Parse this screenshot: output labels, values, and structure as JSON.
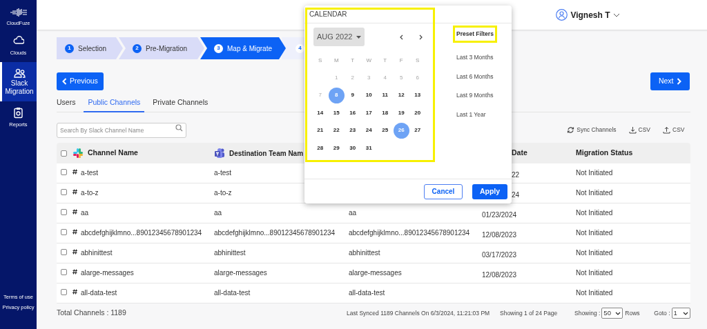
{
  "sidebar": {
    "brand": "CloudFuze",
    "items": [
      {
        "label": "Clouds",
        "kind": "cloud",
        "selected": false
      },
      {
        "label": "Slack Migration",
        "kind": "users",
        "selected": true
      },
      {
        "label": "Reports",
        "kind": "clipboard",
        "selected": false
      }
    ],
    "footer_links": [
      "Terms of use",
      "Privacy policy"
    ]
  },
  "header": {
    "user_name": "Vignesh T"
  },
  "steps": [
    {
      "number": "1",
      "label": "Selection",
      "completed": true,
      "selected": false
    },
    {
      "number": "2",
      "label": "Pre-Migration",
      "completed": true,
      "selected": false
    },
    {
      "number": "3",
      "label": "Map & Migrate",
      "completed": false,
      "selected": true
    },
    {
      "number": "4",
      "completed": false,
      "selected": false
    }
  ],
  "previous_button": "Previous",
  "next_button": "Next",
  "tabs": [
    {
      "label": "Users",
      "selected": false
    },
    {
      "label": "Public Channels",
      "selected": true
    },
    {
      "label": "Private Channels",
      "selected": false
    }
  ],
  "search": {
    "placeholder": "Search By Slack Channel Name"
  },
  "toolbar": [
    {
      "kind": "sync",
      "label": "Sync Channels"
    },
    {
      "kind": "download",
      "label": "CSV"
    },
    {
      "kind": "upload",
      "label": "CSV"
    }
  ],
  "table": {
    "select_all_checked": false,
    "columns": [
      {
        "label": "Channel Name",
        "kind": "slack"
      },
      {
        "label": "Destination Team Nam",
        "kind": "teams"
      },
      {},
      {
        "label": "Date",
        "partial": true
      },
      {
        "label": "Migration Status"
      }
    ],
    "rows": [
      {
        "checked": false,
        "channel_name": "a-test",
        "destination_team_name": "a-test",
        "date": "22",
        "date_partial": true,
        "migration_status": "Not Initiated"
      },
      {
        "checked": false,
        "channel_name": "a-to-z",
        "destination_team_name": "a-to-z",
        "date": "24",
        "date_partial": true,
        "migration_status": "Not Initiated"
      },
      {
        "checked": false,
        "channel_name": "aa",
        "destination_team_name": "aa",
        "column_3": "aa",
        "date": "01/23/2024",
        "migration_status": "Not Initiated"
      },
      {
        "checked": false,
        "channel_name": "abcdefghijklmno...89012345678901234",
        "destination_team_name": "abcdefghijklmno...89012345678901234",
        "column_3": "abcdefghijklmno...89012345678901234",
        "date": "12/08/2023",
        "migration_status": "Not Initiated"
      },
      {
        "checked": false,
        "channel_name": "abhinittest",
        "destination_team_name": "abhinittest",
        "column_3": "abhinittest",
        "date": "03/17/2023",
        "migration_status": "Not Initiated"
      },
      {
        "checked": false,
        "channel_name": "alarge-messages",
        "destination_team_name": "alarge-messages",
        "column_3": "alarge-messages",
        "date": "12/08/2023",
        "migration_status": "Not Initiated"
      },
      {
        "checked": false,
        "channel_name": "all-data-test",
        "destination_team_name": "all-data-test",
        "column_3": "all-data-test",
        "migration_status": "Not Initiated"
      }
    ]
  },
  "footer": {
    "total": "Total Channels : 1189",
    "last_synced": "Last Synced 1189 Channels On 6/3/2024, 11:21:03 PM",
    "page_info": "Showing 1 of 24 Page",
    "showing_label": "Showing :",
    "rows_value": "50",
    "rows_label": "Rows",
    "goto_label": "Goto :",
    "goto_value": "1"
  },
  "calendar": {
    "title": "CALENDAR",
    "highlighted": true,
    "month": "AUG 2022",
    "weekdays": [
      "S",
      "M",
      "T",
      "W",
      "T",
      "F",
      "S"
    ],
    "days": [
      {
        "kind": "blank"
      },
      {
        "kind": "day",
        "label": "1",
        "disabled": true,
        "selected": false
      },
      {
        "kind": "day",
        "label": "2",
        "disabled": true,
        "selected": false
      },
      {
        "kind": "day",
        "label": "3",
        "disabled": true,
        "selected": false
      },
      {
        "kind": "day",
        "label": "4",
        "disabled": true,
        "selected": false
      },
      {
        "kind": "day",
        "label": "5",
        "disabled": true,
        "selected": false
      },
      {
        "kind": "day",
        "label": "6",
        "disabled": true,
        "selected": false
      },
      {
        "kind": "day",
        "label": "7",
        "disabled": true,
        "selected": false
      },
      {
        "kind": "day",
        "label": "8",
        "disabled": false,
        "selected": true
      },
      {
        "kind": "day",
        "label": "9",
        "disabled": false,
        "selected": false
      },
      {
        "kind": "day",
        "label": "10",
        "disabled": false,
        "selected": false
      },
      {
        "kind": "day",
        "label": "11",
        "disabled": false,
        "selected": false
      },
      {
        "kind": "day",
        "label": "12",
        "disabled": false,
        "selected": false
      },
      {
        "kind": "day",
        "label": "13",
        "disabled": false,
        "selected": false
      },
      {
        "kind": "day",
        "label": "14",
        "disabled": false,
        "selected": false
      },
      {
        "kind": "day",
        "label": "15",
        "disabled": false,
        "selected": false
      },
      {
        "kind": "day",
        "label": "16",
        "disabled": false,
        "selected": false
      },
      {
        "kind": "day",
        "label": "17",
        "disabled": false,
        "selected": false
      },
      {
        "kind": "day",
        "label": "18",
        "disabled": false,
        "selected": false
      },
      {
        "kind": "day",
        "label": "19",
        "disabled": false,
        "selected": false
      },
      {
        "kind": "day",
        "label": "20",
        "disabled": false,
        "selected": false
      },
      {
        "kind": "day",
        "label": "21",
        "disabled": false,
        "selected": false
      },
      {
        "kind": "day",
        "label": "22",
        "disabled": false,
        "selected": false
      },
      {
        "kind": "day",
        "label": "23",
        "disabled": false,
        "selected": false
      },
      {
        "kind": "day",
        "label": "24",
        "disabled": false,
        "selected": false
      },
      {
        "kind": "day",
        "label": "25",
        "disabled": false,
        "selected": false
      },
      {
        "kind": "day",
        "label": "26",
        "disabled": false,
        "selected": true
      },
      {
        "kind": "day",
        "label": "27",
        "disabled": false,
        "selected": false
      },
      {
        "kind": "day",
        "label": "28",
        "disabled": false,
        "selected": false
      },
      {
        "kind": "day",
        "label": "29",
        "disabled": false,
        "selected": false
      },
      {
        "kind": "day",
        "label": "30",
        "disabled": false,
        "selected": false
      },
      {
        "kind": "day",
        "label": "31",
        "disabled": false,
        "selected": false
      }
    ],
    "presets_title": "Preset Filters",
    "presets_highlighted": true,
    "presets": [
      "Last 3 Months",
      "Last 6 Months",
      "Last 9 Months",
      "Last 1 Year"
    ],
    "cancel_button": "Cancel",
    "apply_button": "Apply"
  }
}
